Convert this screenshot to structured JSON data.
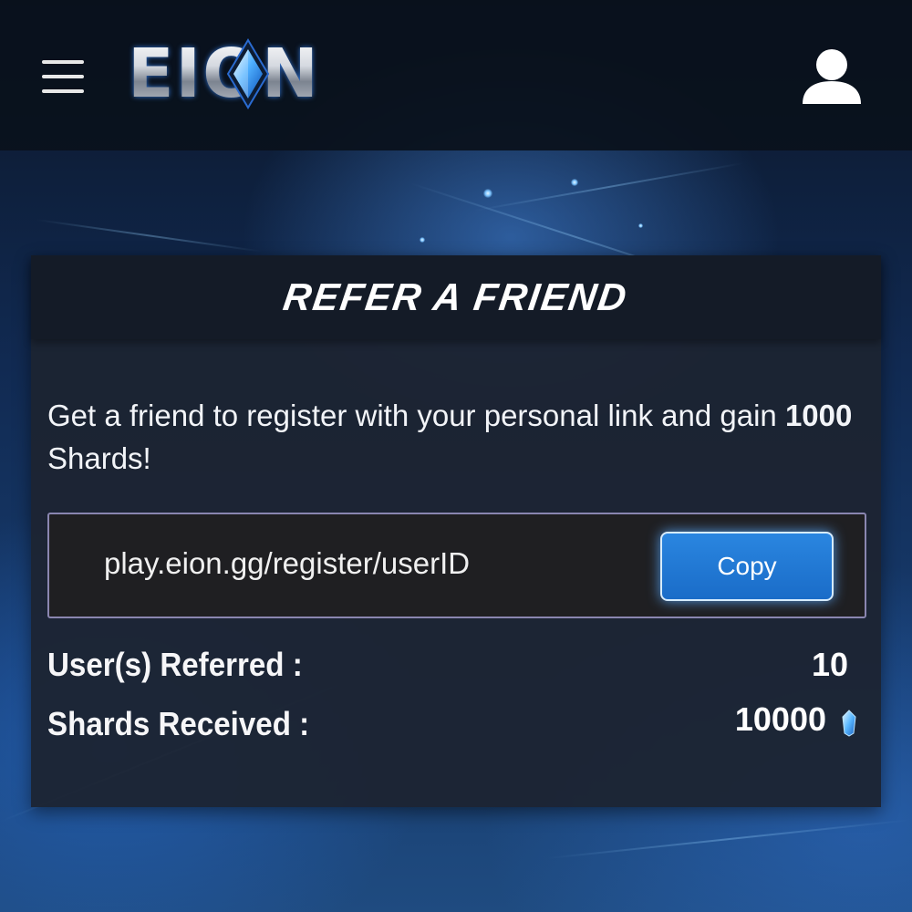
{
  "header": {
    "logo_text": "EION"
  },
  "card": {
    "title": "REFER A FRIEND",
    "description_prefix": "Get a friend to register with your personal link and gain ",
    "reward_amount": "1000",
    "description_suffix": " Shards!",
    "referral_link": "play.eion.gg/register/userID",
    "copy_label": "Copy",
    "stats": {
      "users_referred_label": "User(s) Referred :",
      "users_referred_value": "10",
      "shards_received_label": "Shards Received :",
      "shards_received_value": "10000"
    }
  },
  "colors": {
    "accent": "#1f78d6",
    "card_bg": "#1c2432",
    "header_bg": "#0a111c"
  },
  "icons": [
    "menu-icon",
    "user-profile-icon",
    "shard-gem-icon"
  ]
}
